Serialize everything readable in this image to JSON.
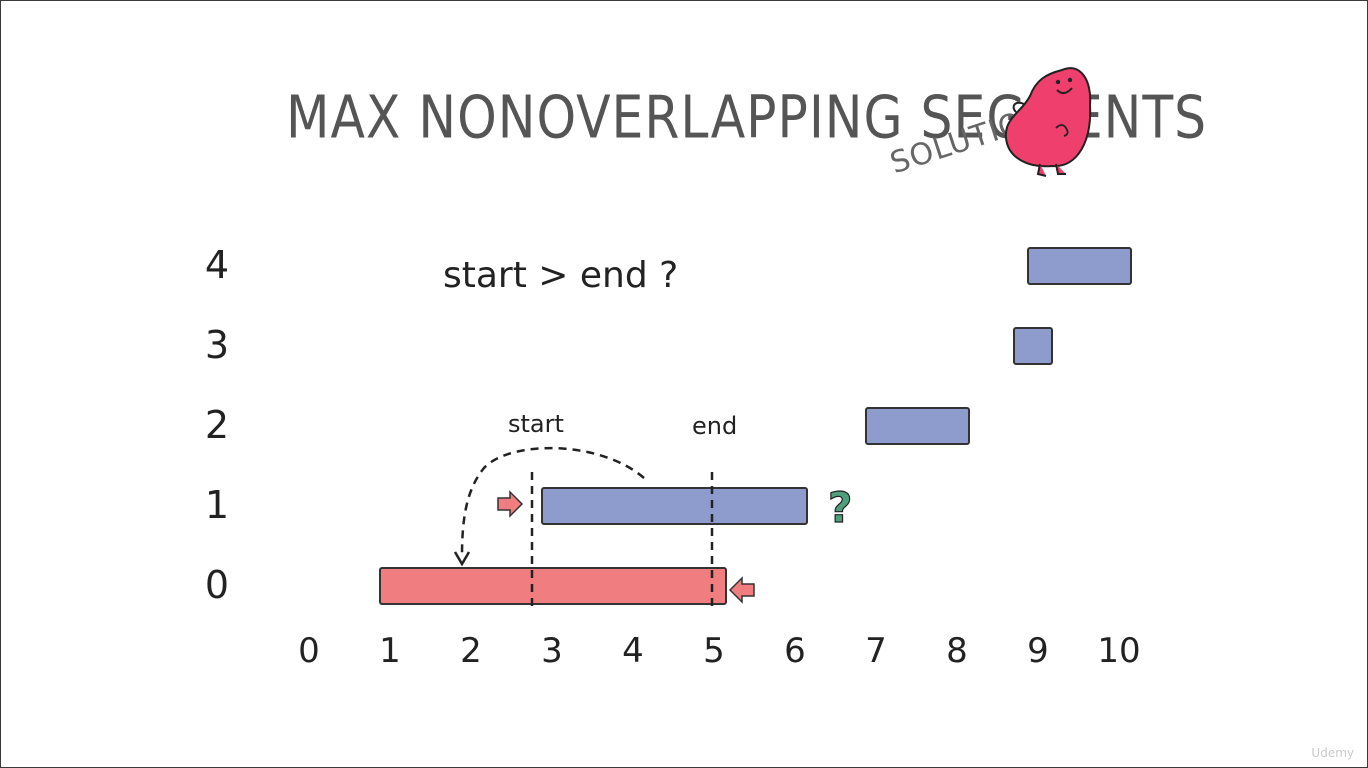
{
  "title": "MAX NONOVERLAPPING SEGMENTS",
  "subtitle": "SOLUTION",
  "question": "start > end ?",
  "labels": {
    "start": "start",
    "end": "end",
    "question_mark": "?"
  },
  "watermark": "Udemy",
  "colors": {
    "blue_segment": "#8d9ccd",
    "red_segment": "#f07d80",
    "question_mark": "#4f9f7c",
    "mascot": "#ef3f6c",
    "arrow": "#f07d80"
  },
  "icons": {
    "mascot": "pink-blob-mascot-icon",
    "arrows": "pointer-arrow-icon"
  },
  "chart_data": {
    "type": "segments",
    "x_ticks": [
      0,
      1,
      2,
      3,
      4,
      5,
      6,
      7,
      8,
      9,
      10
    ],
    "y_ticks": [
      0,
      1,
      2,
      3,
      4
    ],
    "segments": [
      {
        "index": 0,
        "start": 1,
        "end": 5,
        "color": "red"
      },
      {
        "index": 1,
        "start": 3,
        "end": 6,
        "color": "blue"
      },
      {
        "index": 2,
        "start": 7,
        "end": 8,
        "color": "blue"
      },
      {
        "index": 3,
        "start": 9,
        "end": 9,
        "color": "blue"
      },
      {
        "index": 4,
        "start": 9,
        "end": 10,
        "color": "blue"
      }
    ]
  }
}
